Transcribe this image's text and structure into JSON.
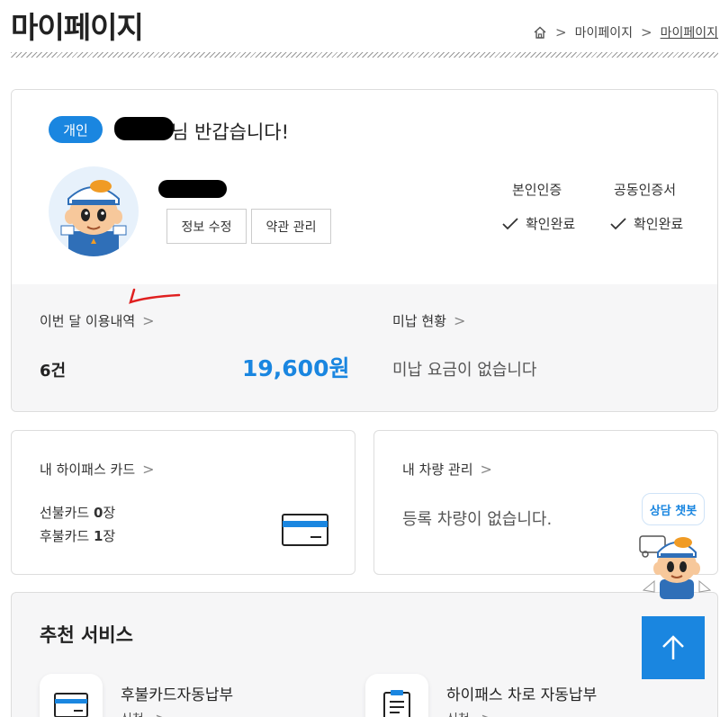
{
  "header": {
    "title": "마이페이지",
    "breadcrumb": [
      "마이페이지",
      "마이페이지"
    ]
  },
  "profile": {
    "badge": "개인",
    "greeting": "님 반갑습니다!",
    "buttons": {
      "edit": "정보 수정",
      "terms": "약관 관리"
    },
    "auth": [
      {
        "label": "본인인증",
        "status": "확인완료"
      },
      {
        "label": "공동인증서",
        "status": "확인완료"
      }
    ]
  },
  "usage": {
    "link": "이번 달 이용내역",
    "count": "6건",
    "amount": "19,600원"
  },
  "unpaid": {
    "link": "미납 현황",
    "message": "미납 요금이 없습니다"
  },
  "hipass": {
    "link": "내 하이패스 카드",
    "prepaid_label": "선불카드 ",
    "prepaid_count": "0",
    "prepaid_unit": "장",
    "postpaid_label": "후불카드 ",
    "postpaid_count": "1",
    "postpaid_unit": "장"
  },
  "vehicle": {
    "link": "내 차량 관리",
    "message": "등록 차량이 없습니다."
  },
  "recommend": {
    "title": "추천 서비스",
    "items": [
      {
        "name": "후불카드자동납부",
        "action": "신청"
      },
      {
        "name": "하이패스 차로 자동납부",
        "action": "신청"
      }
    ]
  },
  "chatbot": {
    "label": "상담 챗봇"
  },
  "colors": {
    "accent": "#1a86e0",
    "panel": "#f6f6f7"
  }
}
